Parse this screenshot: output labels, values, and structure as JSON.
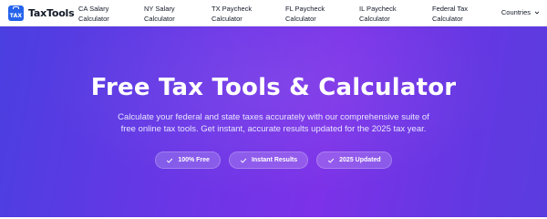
{
  "brand": {
    "logo_badge_text": "TAX",
    "logo_text": "TaxTools",
    "accent": "#2563eb"
  },
  "nav": {
    "links": [
      {
        "line1": "CA Salary",
        "line2": "Calculator"
      },
      {
        "line1": "NY Salary",
        "line2": "Calculator"
      },
      {
        "line1": "TX Paycheck",
        "line2": "Calculator"
      },
      {
        "line1": "FL Paycheck",
        "line2": "Calculator"
      },
      {
        "line1": "IL Paycheck",
        "line2": "Calculator"
      },
      {
        "line1": "Federal Tax",
        "line2": "Calculator"
      }
    ],
    "countries_label": "Countries",
    "countries_icon": "chevron-down-icon"
  },
  "hero": {
    "title": "Free Tax Tools & Calculator",
    "subtitle": "Calculate your federal and state taxes accurately with our comprehensive suite of free online tax tools. Get instant, accurate results updated for the 2025 tax year.",
    "gradient_colors": [
      "#4a3fe0",
      "#7c32e8",
      "#5a3ddf"
    ],
    "pills": [
      {
        "label": "100% Free",
        "icon": "check-icon"
      },
      {
        "label": "Instant Results",
        "icon": "check-icon"
      },
      {
        "label": "2025 Updated",
        "icon": "check-icon"
      }
    ]
  }
}
